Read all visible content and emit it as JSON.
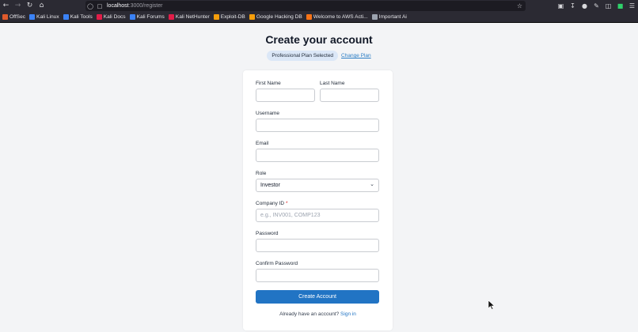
{
  "browser": {
    "url_host": "localhost",
    "url_path": ":3000/register",
    "bookmarks": [
      {
        "label": "OffSec",
        "color": "#e05a2b"
      },
      {
        "label": "Kali Linux",
        "color": "#3b82f6"
      },
      {
        "label": "Kali Tools",
        "color": "#3b82f6"
      },
      {
        "label": "Kali Docs",
        "color": "#e11d48"
      },
      {
        "label": "Kali Forums",
        "color": "#3b82f6"
      },
      {
        "label": "Kali NetHunter",
        "color": "#e11d48"
      },
      {
        "label": "Exploit-DB",
        "color": "#f59e0b"
      },
      {
        "label": "Google Hacking DB",
        "color": "#f59e0b"
      },
      {
        "label": "Welcome to AWS Acti...",
        "color": "#f97316"
      },
      {
        "label": "Important Ai",
        "color": "#9ca3af"
      }
    ]
  },
  "page": {
    "title": "Create your account",
    "plan_badge": "Professional Plan Selected",
    "change_plan": "Change Plan"
  },
  "form": {
    "first_name_label": "First Name",
    "last_name_label": "Last Name",
    "username_label": "Username",
    "email_label": "Email",
    "role_label": "Role",
    "role_value": "Investor",
    "company_id_label": "Company ID",
    "company_id_required": "*",
    "company_id_placeholder": "e.g., INV001, COMP123",
    "password_label": "Password",
    "confirm_password_label": "Confirm Password",
    "submit": "Create Account",
    "signin_prompt": "Already have an account?",
    "signin_link": "Sign in"
  },
  "colors": {
    "primary": "#2174c4",
    "required": "#dc2626"
  }
}
